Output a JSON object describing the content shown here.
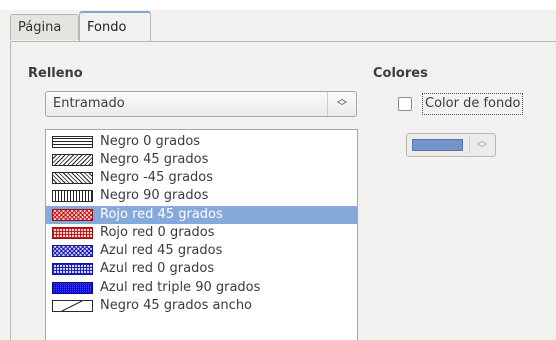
{
  "tabs": [
    {
      "label": "Página"
    },
    {
      "label": "Fondo"
    }
  ],
  "fill_section": {
    "title": "Relleno",
    "type_select": {
      "value": "Entramado"
    },
    "hatch_list": [
      {
        "label": "Negro 0 grados",
        "selected": false
      },
      {
        "label": "Negro 45 grados",
        "selected": false
      },
      {
        "label": "Negro -45 grados",
        "selected": false
      },
      {
        "label": "Negro 90 grados",
        "selected": false
      },
      {
        "label": "Rojo red 45 grados",
        "selected": true
      },
      {
        "label": "Rojo red 0 grados",
        "selected": false
      },
      {
        "label": "Azul red 45 grados",
        "selected": false
      },
      {
        "label": "Azul red 0 grados",
        "selected": false
      },
      {
        "label": "Azul red triple 90 grados",
        "selected": false
      },
      {
        "label": "Negro 45 grados ancho",
        "selected": false
      }
    ]
  },
  "colors_section": {
    "title": "Colores",
    "background_color_checkbox": {
      "label": "Color de fondo",
      "checked": false
    },
    "color_picker": {
      "color": "#7493c9",
      "enabled": false
    }
  },
  "theme": {
    "selection_color": "#86a9dc",
    "active_tab_accent": "#7fa6d6"
  }
}
